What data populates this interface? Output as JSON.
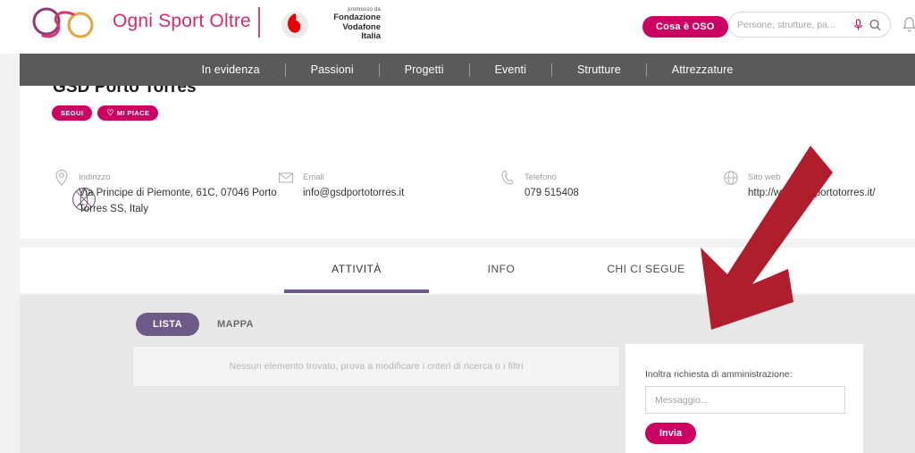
{
  "header": {
    "logo_icon": "oso-rings-logo",
    "brand_name": "Ogni Sport Oltre",
    "partner": {
      "icon": "vodafone-logo",
      "promo_label": "promosso da",
      "line1": "Fondazione",
      "line2": "Vodafone",
      "line3": "Italia"
    },
    "cta_label": "Cosa è OSO",
    "search": {
      "placeholder": "Persone, strutture, pa...",
      "value": "",
      "mic_icon": "microphone-icon",
      "search_icon": "magnifier-icon"
    },
    "bell_icon": "notification-bell-icon"
  },
  "nav": {
    "items": [
      {
        "label": "In evidenza"
      },
      {
        "label": "Passioni"
      },
      {
        "label": "Progetti"
      },
      {
        "label": "Eventi"
      },
      {
        "label": "Strutture"
      },
      {
        "label": "Attrezzature"
      }
    ]
  },
  "profile": {
    "title": "GSD Porto Torres",
    "follow_label": "SEGUI",
    "like_label": "MI PIACE",
    "like_icon": "heart-icon",
    "sport_icon": "basketball-icon",
    "contacts": [
      {
        "icon": "map-pin-icon",
        "label": "Indirizzo",
        "value": "Via Principe di Piemonte, 61C, 07046 Porto Torres SS, Italy"
      },
      {
        "icon": "envelope-icon",
        "label": "Email",
        "value": "info@gsdportotorres.it"
      },
      {
        "icon": "phone-icon",
        "label": "Telefono",
        "value": "079 515408"
      },
      {
        "icon": "globe-icon",
        "label": "Sito web",
        "value": "http://www.gsdportotorres.it/"
      }
    ]
  },
  "tabs": [
    {
      "label": "ATTIVITÀ",
      "active": true
    },
    {
      "label": "INFO",
      "active": false
    },
    {
      "label": "CHI CI SEGUE",
      "active": false
    }
  ],
  "content": {
    "view_toggle": {
      "list_label": "LISTA",
      "map_label": "MAPPA",
      "selected": "LISTA"
    },
    "empty_message": "Nessun elemento trovato, prova a modificare i criteri di ricerca o i filtri",
    "admin_request": {
      "title": "Inoltra richiesta di amministrazione:",
      "message_placeholder": "Messaggio...",
      "message_value": "",
      "submit_label": "Invia"
    }
  },
  "annotation": {
    "arrow_icon": "red-down-left-arrow",
    "color": "#b01e2e"
  },
  "colors": {
    "brand_pink": "#cc0063",
    "brand_magenta": "#d32a6e",
    "nav_gray": "#5a5a5a",
    "tab_purple": "#6e5a86",
    "content_gray": "#e7e7e7",
    "annotation_red": "#b01e2e"
  }
}
